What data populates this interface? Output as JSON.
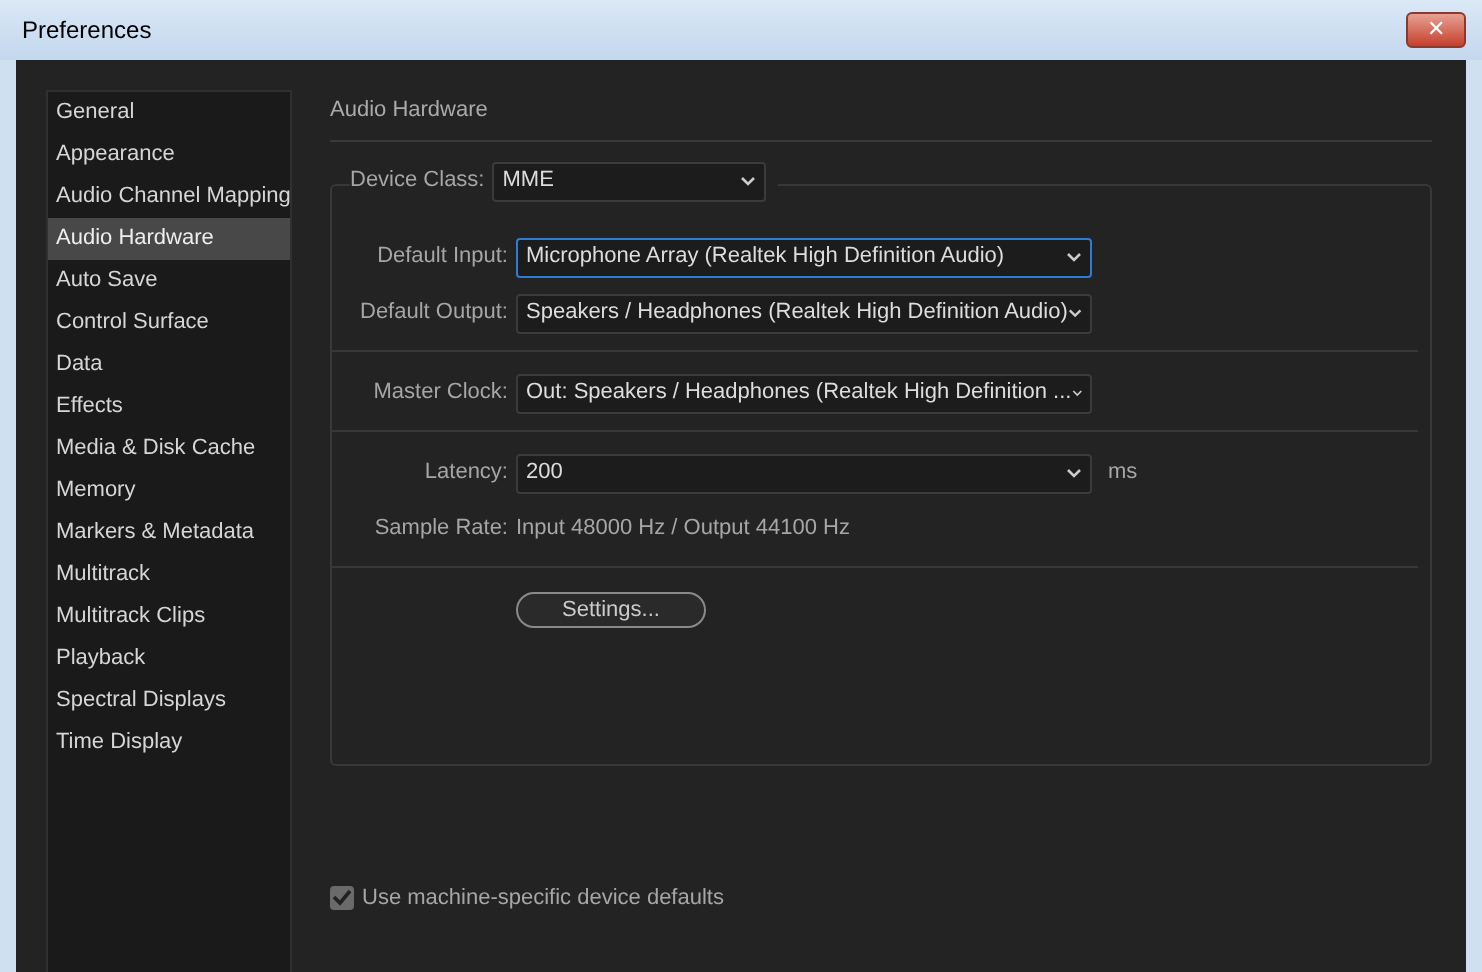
{
  "window": {
    "title": "Preferences",
    "close": "✕"
  },
  "sidebar": {
    "items": [
      {
        "label": "General",
        "selected": false
      },
      {
        "label": "Appearance",
        "selected": false
      },
      {
        "label": "Audio Channel Mapping",
        "selected": false
      },
      {
        "label": "Audio Hardware",
        "selected": true
      },
      {
        "label": "Auto Save",
        "selected": false
      },
      {
        "label": "Control Surface",
        "selected": false
      },
      {
        "label": "Data",
        "selected": false
      },
      {
        "label": "Effects",
        "selected": false
      },
      {
        "label": "Media & Disk Cache",
        "selected": false
      },
      {
        "label": "Memory",
        "selected": false
      },
      {
        "label": "Markers & Metadata",
        "selected": false
      },
      {
        "label": "Multitrack",
        "selected": false
      },
      {
        "label": "Multitrack Clips",
        "selected": false
      },
      {
        "label": "Playback",
        "selected": false
      },
      {
        "label": "Spectral Displays",
        "selected": false
      },
      {
        "label": "Time Display",
        "selected": false
      }
    ]
  },
  "section": {
    "title": "Audio Hardware",
    "device_class": {
      "label": "Device Class:",
      "value": "MME"
    },
    "groups": [
      [
        {
          "kind": "select",
          "label": "Default Input:",
          "value": "Microphone Array (Realtek High Definition Audio)",
          "focused": true
        },
        {
          "kind": "select",
          "label": "Default Output:",
          "value": "Speakers / Headphones (Realtek High Definition Audio)",
          "focused": false
        }
      ],
      [
        {
          "kind": "select",
          "label": "Master Clock:",
          "value": "Out: Speakers / Headphones (Realtek High Definition ...",
          "focused": false
        }
      ],
      [
        {
          "kind": "select",
          "label": "Latency:",
          "value": "200",
          "focused": false,
          "unit": "ms"
        },
        {
          "kind": "text",
          "label": "Sample Rate:",
          "value": "Input 48000 Hz / Output 44100 Hz"
        }
      ],
      [
        {
          "kind": "button",
          "value": "Settings..."
        }
      ]
    ],
    "checkbox": {
      "label": "Use machine-specific device defaults",
      "checked": true
    }
  }
}
